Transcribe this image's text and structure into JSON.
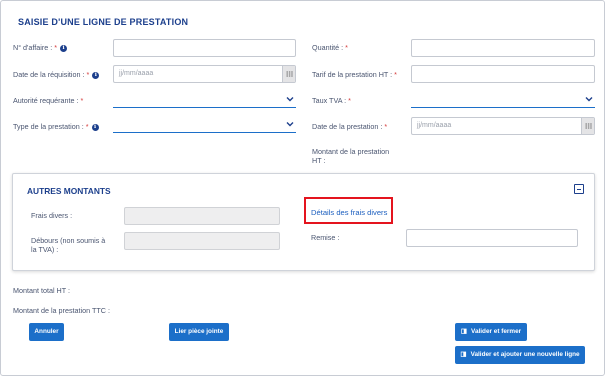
{
  "form": {
    "title": "SAISIE D'UNE LIGNE DE PRESTATION",
    "req_mark": "*",
    "fields": {
      "no_affaire": {
        "label": "N° d'affaire :"
      },
      "quantite": {
        "label": "Quantité :"
      },
      "date_requisition": {
        "label": "Date de la réquisition :",
        "placeholder": "jj/mm/aaaa"
      },
      "tarif_ht": {
        "label": "Tarif de la prestation HT :"
      },
      "autorite": {
        "label": "Autorité requérante :"
      },
      "taux_tva": {
        "label": "Taux TVA :"
      },
      "type_prestation": {
        "label": "Type de la prestation :"
      },
      "date_prestation": {
        "label": "Date de la prestation :",
        "placeholder": "jj/mm/aaaa"
      },
      "montant_ht_line1": "Montant de la prestation",
      "montant_ht_line2": "HT :"
    }
  },
  "autres_montants": {
    "title": "AUTRES MONTANTS",
    "frais_divers": "Frais divers :",
    "details_link": "Détails des frais divers",
    "debours_line1": "Débours (non soumis à",
    "debours_line2": "la TVA) :",
    "remise": "Remise :"
  },
  "totals": {
    "montant_total_ht": "Montant total HT :",
    "montant_ttc": "Montant de la prestation TTC :"
  },
  "buttons": {
    "annuler": "Annuler",
    "lier": "Lier pièce jointe",
    "valider_fermer": "Valider et fermer",
    "valider_ajouter": "Valider et ajouter une nouvelle ligne"
  },
  "colors": {
    "accent": "#1c6fc9",
    "title": "#1c3f8c",
    "required": "#d43838",
    "highlight": "#e4141e"
  },
  "icons": {
    "info": "info-circle-icon",
    "calendar": "calendar-icon",
    "chevron": "chevron-down-icon",
    "collapse": "collapse-icon",
    "save": "save-icon"
  }
}
